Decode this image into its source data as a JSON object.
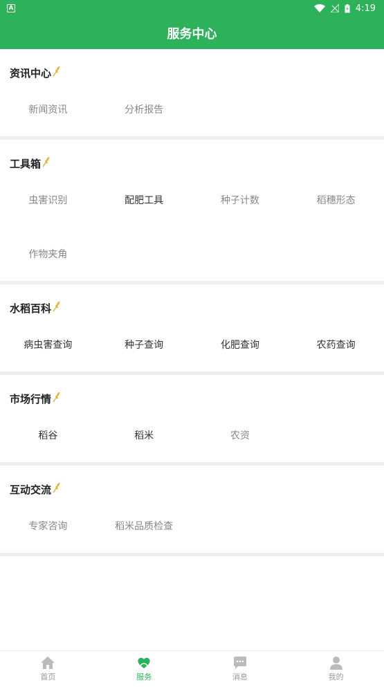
{
  "statusbar": {
    "time": "4:19",
    "left_icon": "A"
  },
  "appbar": {
    "title": "服务中心"
  },
  "sections": [
    {
      "title": "资讯中心",
      "items": [
        "新闻资讯",
        "分析报告"
      ]
    },
    {
      "title": "工具箱",
      "items": [
        "虫害识别",
        "配肥工具",
        "种子计数",
        "稻穗形态",
        "作物夹角"
      ]
    },
    {
      "title": "水稻百科",
      "items": [
        "病虫害查询",
        "种子查询",
        "化肥查询",
        "农药查询"
      ]
    },
    {
      "title": "市场行情",
      "items": [
        "稻谷",
        "稻米",
        "农资"
      ]
    },
    {
      "title": "互动交流",
      "items": [
        "专家咨询",
        "稻米品质检查"
      ]
    }
  ],
  "bottom_nav": [
    {
      "label": "首页",
      "icon": "home-icon"
    },
    {
      "label": "服务",
      "icon": "service-heart-icon",
      "active": true
    },
    {
      "label": "消息",
      "icon": "message-icon"
    },
    {
      "label": "我的",
      "icon": "user-icon"
    }
  ],
  "colors": {
    "primary": "#2db25b",
    "accent_wheat": "#e2b53c"
  }
}
